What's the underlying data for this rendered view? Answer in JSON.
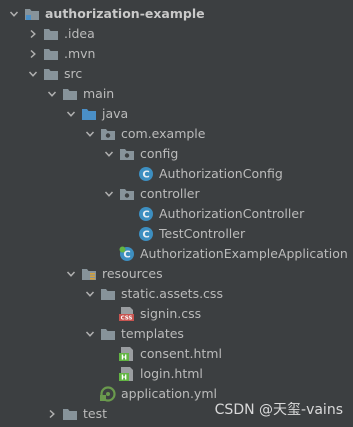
{
  "tree": [
    {
      "label": "authorization-example",
      "depth": 0,
      "arrow": "down",
      "icon": "project-folder-icon",
      "bold": true
    },
    {
      "label": ".idea",
      "depth": 1,
      "arrow": "right",
      "icon": "folder-icon"
    },
    {
      "label": ".mvn",
      "depth": 1,
      "arrow": "right",
      "icon": "folder-icon"
    },
    {
      "label": "src",
      "depth": 1,
      "arrow": "down",
      "icon": "folder-icon"
    },
    {
      "label": "main",
      "depth": 2,
      "arrow": "down",
      "icon": "folder-icon"
    },
    {
      "label": "java",
      "depth": 3,
      "arrow": "down",
      "icon": "source-folder-icon"
    },
    {
      "label": "com.example",
      "depth": 4,
      "arrow": "down",
      "icon": "package-icon"
    },
    {
      "label": "config",
      "depth": 5,
      "arrow": "down",
      "icon": "package-icon"
    },
    {
      "label": "AuthorizationConfig",
      "depth": 6,
      "arrow": "none",
      "icon": "class-icon"
    },
    {
      "label": "controller",
      "depth": 5,
      "arrow": "down",
      "icon": "package-icon"
    },
    {
      "label": "AuthorizationController",
      "depth": 6,
      "arrow": "none",
      "icon": "class-icon"
    },
    {
      "label": "TestController",
      "depth": 6,
      "arrow": "none",
      "icon": "class-icon"
    },
    {
      "label": "AuthorizationExampleApplication",
      "depth": 5,
      "arrow": "none",
      "icon": "spring-boot-class-icon"
    },
    {
      "label": "resources",
      "depth": 3,
      "arrow": "down",
      "icon": "resources-folder-icon"
    },
    {
      "label": "static.assets.css",
      "depth": 4,
      "arrow": "down",
      "icon": "folder-icon"
    },
    {
      "label": "signin.css",
      "depth": 5,
      "arrow": "none",
      "icon": "css-file-icon"
    },
    {
      "label": "templates",
      "depth": 4,
      "arrow": "down",
      "icon": "folder-icon"
    },
    {
      "label": "consent.html",
      "depth": 5,
      "arrow": "none",
      "icon": "html-file-icon"
    },
    {
      "label": "login.html",
      "depth": 5,
      "arrow": "none",
      "icon": "html-file-icon"
    },
    {
      "label": "application.yml",
      "depth": 4,
      "arrow": "none",
      "icon": "yml-file-icon"
    },
    {
      "label": "test",
      "depth": 2,
      "arrow": "right",
      "icon": "folder-icon"
    }
  ],
  "icon_text": {
    "css": "CSS",
    "html": "H"
  },
  "watermark": "CSDN @天玺-vains",
  "colors": {
    "background": "#3c3f41",
    "folder": "#87939a",
    "source_folder": "#4a8fc7",
    "class_circle": "#3d8fc1",
    "html_green": "#62b543",
    "css_red": "#c75450",
    "yml_green": "#6a9a4d"
  }
}
